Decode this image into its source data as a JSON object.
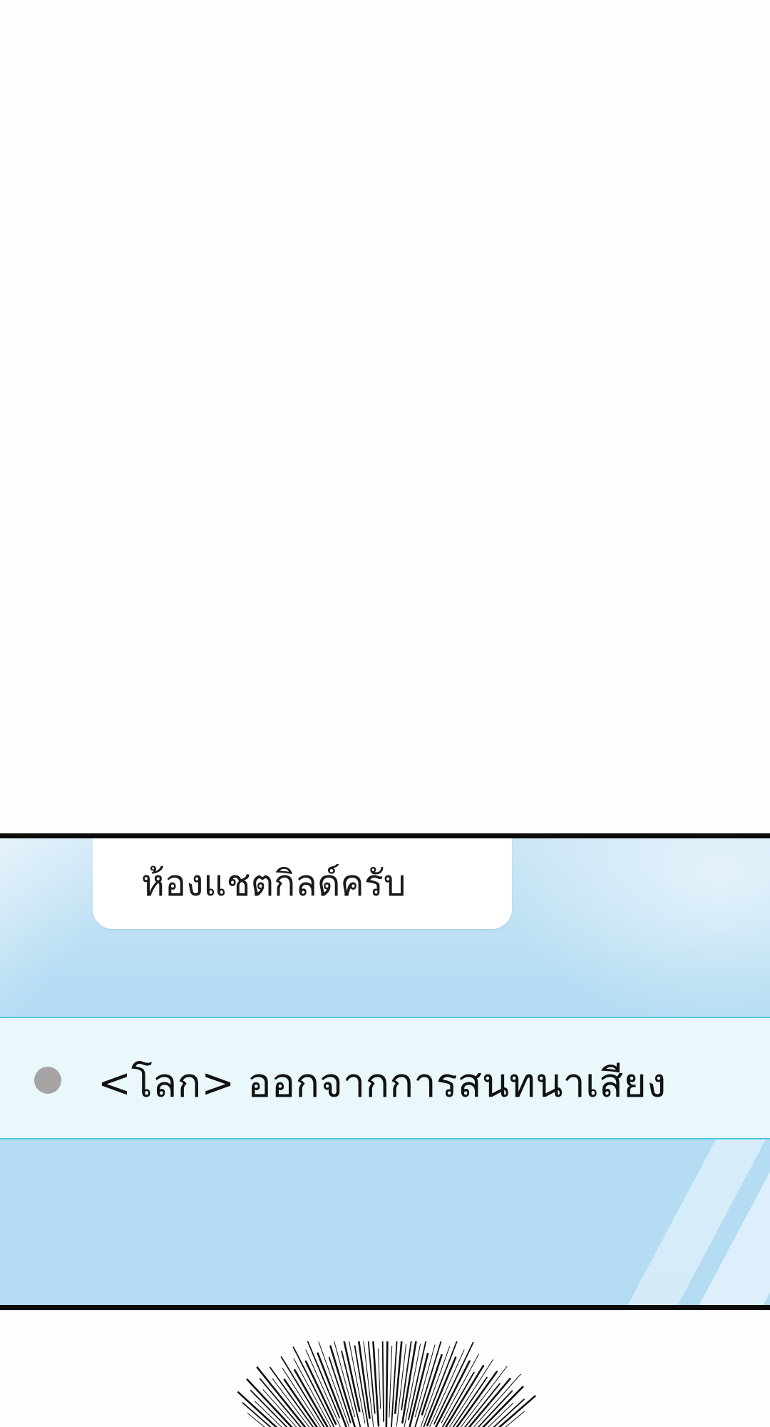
{
  "chat_panel": {
    "tab_label": "ห้องแชตกิลด์ครับ",
    "system_message": {
      "text": "<โลก> ออกจากการสนทนาเสียง",
      "indicator_color": "#a4a4a4"
    },
    "colors": {
      "panel_background": "#b6ddf3",
      "message_row_background": "#eaf8fc",
      "message_row_border": "#52c6dc",
      "panel_border": "#0b0b0b"
    }
  },
  "decorations": {
    "burst_icon": "speed-lines-burst"
  }
}
